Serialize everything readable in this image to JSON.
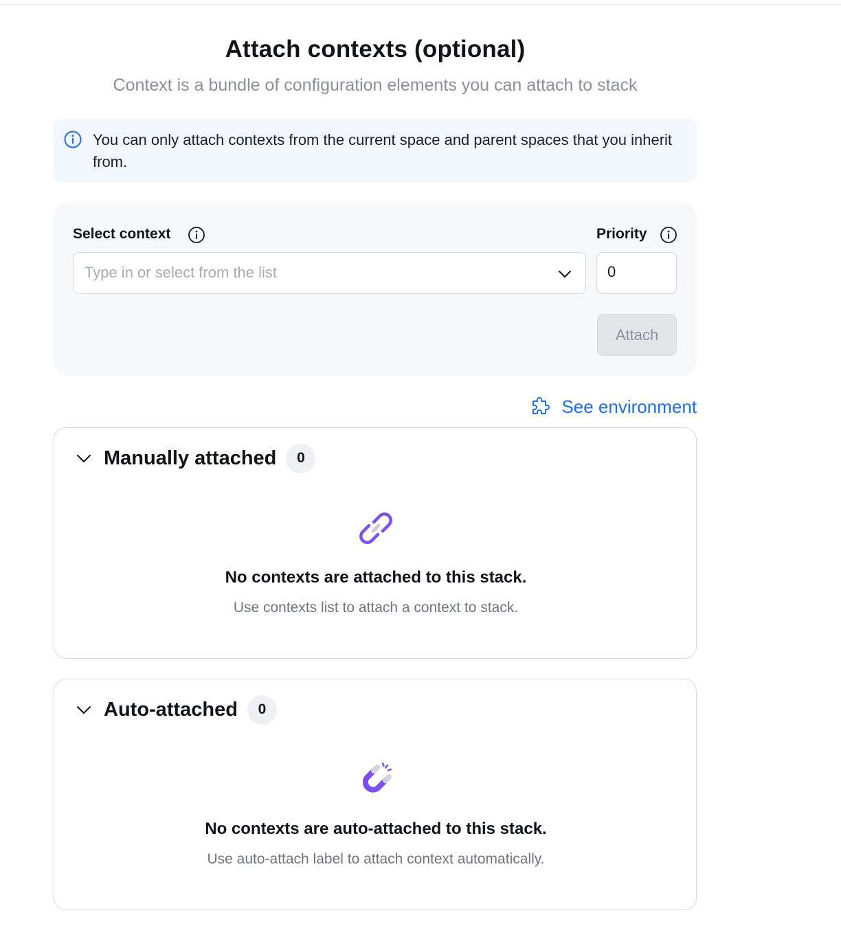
{
  "header": {
    "title": "Attach contexts (optional)",
    "subtitle": "Context is a bundle of configuration elements you can attach to stack"
  },
  "info_banner": {
    "text": "You can only attach contexts from the current space and parent spaces that you inherit from.",
    "icon": "info-icon"
  },
  "form": {
    "select_context_label": "Select context",
    "select_context_placeholder": "Type in or select from the list",
    "priority_label": "Priority",
    "priority_value": "0",
    "attach_label": "Attach"
  },
  "see_environment": {
    "label": "See environment",
    "icon": "puzzle-icon"
  },
  "sections": {
    "manual": {
      "title": "Manually attached",
      "count": "0",
      "empty_title": "No contexts are attached to this stack.",
      "empty_subtitle": "Use contexts list to attach a context to stack.",
      "icon": "link-icon"
    },
    "auto": {
      "title": "Auto-attached",
      "count": "0",
      "empty_title": "No contexts are auto-attached to this stack.",
      "empty_subtitle": "Use auto-attach label to attach context automatically.",
      "icon": "magnet-icon"
    }
  },
  "colors": {
    "accent_link": "#1f6fe5",
    "icon_purple": "#7b4ff0",
    "info_bg": "#f1f7fd",
    "panel_bg": "#f7f8fa"
  }
}
